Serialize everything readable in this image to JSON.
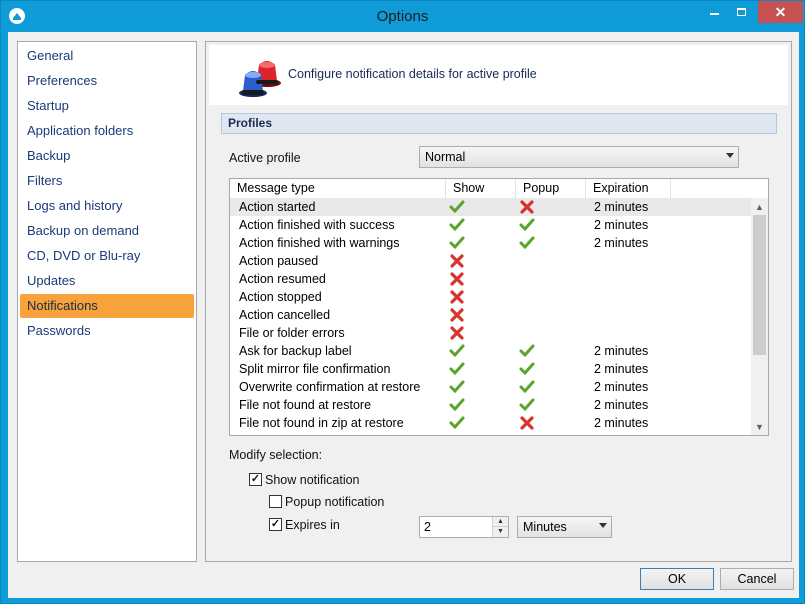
{
  "window": {
    "title": "Options",
    "icon": "app-eject-icon",
    "close_glyph": "✕"
  },
  "sidebar": {
    "selected": "Notifications",
    "items": [
      {
        "label": "General"
      },
      {
        "label": "Preferences"
      },
      {
        "label": "Startup"
      },
      {
        "label": "Application folders"
      },
      {
        "label": "Backup"
      },
      {
        "label": "Filters"
      },
      {
        "label": "Logs and history"
      },
      {
        "label": "Backup on demand"
      },
      {
        "label": "CD, DVD or Blu-ray"
      },
      {
        "label": "Updates"
      },
      {
        "label": "Notifications"
      },
      {
        "label": "Passwords"
      }
    ]
  },
  "header": {
    "text": "Configure notification details for active profile",
    "icon": "siren-lights-icon"
  },
  "profiles": {
    "section_title": "Profiles",
    "active_profile_label": "Active profile",
    "active_profile_value": "Normal"
  },
  "table": {
    "columns": [
      "Message type",
      "Show",
      "Popup",
      "Expiration"
    ],
    "rows": [
      {
        "message": "Action started",
        "show": "check",
        "popup": "cross",
        "expiration": "2 minutes",
        "selected": true
      },
      {
        "message": "Action finished with success",
        "show": "check",
        "popup": "check",
        "expiration": "2 minutes"
      },
      {
        "message": "Action finished with warnings",
        "show": "check",
        "popup": "check",
        "expiration": "2 minutes"
      },
      {
        "message": "Action paused",
        "show": "cross",
        "popup": "",
        "expiration": ""
      },
      {
        "message": "Action resumed",
        "show": "cross",
        "popup": "",
        "expiration": ""
      },
      {
        "message": "Action stopped",
        "show": "cross",
        "popup": "",
        "expiration": ""
      },
      {
        "message": "Action cancelled",
        "show": "cross",
        "popup": "",
        "expiration": ""
      },
      {
        "message": "File or folder errors",
        "show": "cross",
        "popup": "",
        "expiration": ""
      },
      {
        "message": "Ask for backup label",
        "show": "check",
        "popup": "check",
        "expiration": "2 minutes"
      },
      {
        "message": "Split mirror file confirmation",
        "show": "check",
        "popup": "check",
        "expiration": "2 minutes"
      },
      {
        "message": "Overwrite confirmation at restore",
        "show": "check",
        "popup": "check",
        "expiration": "2 minutes"
      },
      {
        "message": "File not found at restore",
        "show": "check",
        "popup": "check",
        "expiration": "2 minutes"
      },
      {
        "message": "File not found in zip at restore",
        "show": "check",
        "popup": "cross",
        "expiration": "2 minutes"
      }
    ]
  },
  "modify": {
    "label": "Modify selection:",
    "show_notification": {
      "label": "Show notification",
      "checked": true
    },
    "popup_notification": {
      "label": "Popup notification",
      "checked": false
    },
    "expires_in": {
      "label": "Expires in",
      "checked": true,
      "value": "2",
      "unit": "Minutes"
    }
  },
  "buttons": {
    "ok": "OK",
    "cancel": "Cancel"
  },
  "colors": {
    "title_bar": "#0f9bd8",
    "selected_item": "#f7a23b",
    "check": "#5aa42a",
    "cross": "#d8322b"
  }
}
